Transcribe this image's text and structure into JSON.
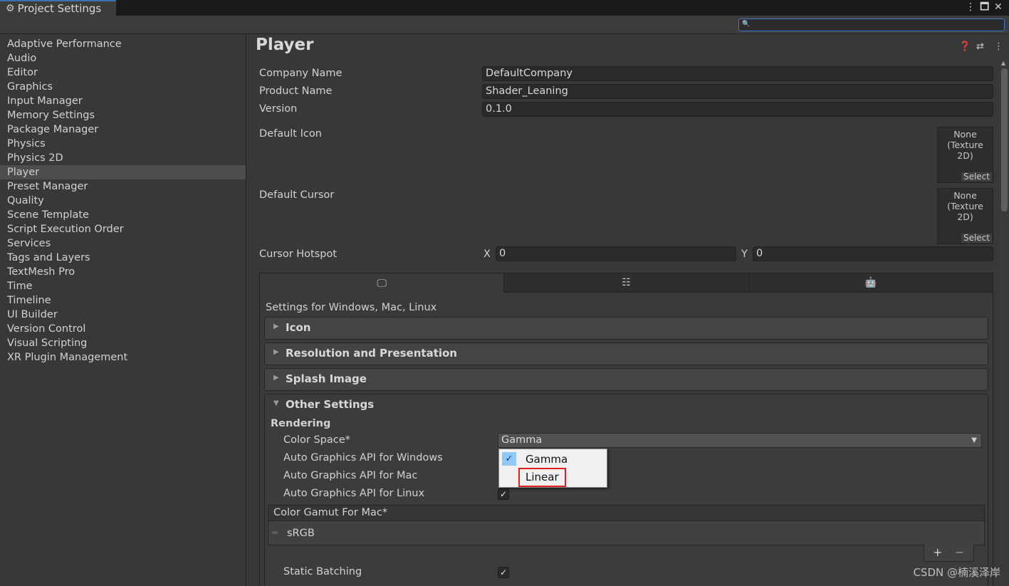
{
  "window": {
    "title": "Project Settings",
    "more_icon": "⋮",
    "maximize_icon": "🗖",
    "close_icon": "✕"
  },
  "search": {
    "value": "",
    "placeholder": ""
  },
  "sidebar": {
    "items": [
      {
        "label": "Adaptive Performance"
      },
      {
        "label": "Audio"
      },
      {
        "label": "Editor"
      },
      {
        "label": "Graphics"
      },
      {
        "label": "Input Manager"
      },
      {
        "label": "Memory Settings"
      },
      {
        "label": "Package Manager"
      },
      {
        "label": "Physics"
      },
      {
        "label": "Physics 2D"
      },
      {
        "label": "Player"
      },
      {
        "label": "Preset Manager"
      },
      {
        "label": "Quality"
      },
      {
        "label": "Scene Template"
      },
      {
        "label": "Script Execution Order"
      },
      {
        "label": "Services"
      },
      {
        "label": "Tags and Layers"
      },
      {
        "label": "TextMesh Pro"
      },
      {
        "label": "Time"
      },
      {
        "label": "Timeline"
      },
      {
        "label": "UI Builder"
      },
      {
        "label": "Version Control"
      },
      {
        "label": "Visual Scripting"
      },
      {
        "label": "XR Plugin Management"
      }
    ],
    "active_index": 9
  },
  "player": {
    "title": "Player",
    "company_label": "Company Name",
    "company_value": "DefaultCompany",
    "product_label": "Product Name",
    "product_value": "Shader_Leaning",
    "version_label": "Version",
    "version_value": "0.1.0",
    "default_icon_label": "Default Icon",
    "default_cursor_label": "Default Cursor",
    "texture_none": "None",
    "texture_type": "(Texture 2D)",
    "select_label": "Select",
    "hotspot_label": "Cursor Hotspot",
    "hotspot_x_label": "X",
    "hotspot_x_value": "0",
    "hotspot_y_label": "Y",
    "hotspot_y_value": "0"
  },
  "platform": {
    "tabs": [
      {
        "icon": "monitor-icon",
        "glyph": "🖵"
      },
      {
        "icon": "server-icon",
        "glyph": "☷"
      },
      {
        "icon": "android-icon",
        "glyph": "🤖"
      }
    ],
    "settings_for": "Settings for Windows, Mac, Linux",
    "sections": [
      {
        "title": "Icon"
      },
      {
        "title": "Resolution and Presentation"
      },
      {
        "title": "Splash Image"
      }
    ],
    "other_settings": {
      "title": "Other Settings",
      "rendering_label": "Rendering",
      "color_space_label": "Color Space*",
      "color_space_value": "Gamma",
      "auto_win_label": "Auto Graphics API  for Windows",
      "auto_mac_label": "Auto Graphics API  for Mac",
      "auto_linux_label": "Auto Graphics API  for Linux",
      "gamut_label": "Color Gamut For Mac*",
      "gamut_item": "sRGB",
      "add_label": "+",
      "remove_label": "−",
      "static_batching_label": "Static Batching"
    }
  },
  "dropdown": {
    "options": [
      {
        "label": "Gamma",
        "checked": true
      },
      {
        "label": "Linear",
        "checked": false
      }
    ]
  },
  "watermark": "CSDN @楠溪泽岸",
  "colors": {
    "accent": "#3a72b0",
    "highlight_box": "#e02020",
    "checked_bg": "#90c8f6"
  }
}
